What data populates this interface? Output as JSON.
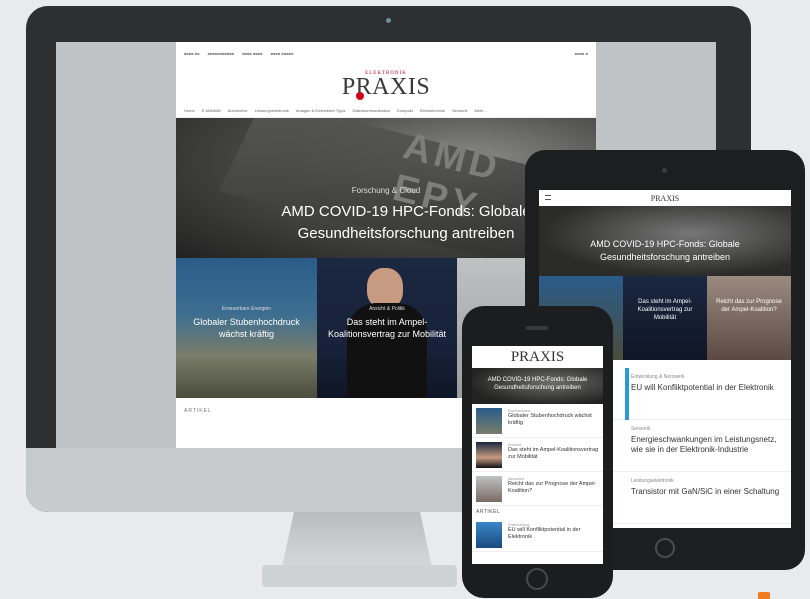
{
  "site": {
    "brand_kicker": "ELEKTRONIK",
    "brand_name": "PRAXIS",
    "topbar": [
      "■■■■ ■■",
      "■■■■■■■■■■■",
      "■■■■ ■■■■",
      "■■■■ ■■■■■"
    ],
    "topbar_right": "■■■■ ■",
    "nav": [
      "Home",
      "E-Mobilität",
      "Automotive",
      "Leistungselektronik",
      "Anlagen & Embedded Tipps",
      "Datenkommunikation",
      "Kompakt",
      "Elektrotechnik",
      "Sensorik",
      "Mehr..."
    ],
    "hero": {
      "kicker": "Forschung & Cloud",
      "title": "AMD COVID-19 HPC-Fonds: Globale Gesundheitsforschung antreiben",
      "chip_text": "AMD EPY"
    },
    "tiles": [
      {
        "kicker": "Erneuerbare Energien",
        "title": "Globaler Stubenhochdruck wächst kräftig"
      },
      {
        "kicker": "Ansicht & Politik",
        "title": "Das steht im Ampel-Koalitionsvertrag zur Mobilität"
      },
      {
        "kicker": "",
        "title": ""
      }
    ],
    "section_label": "ARTIKEL"
  },
  "tablet": {
    "logo": "PRAXIS",
    "hero_title": "AMD COVID-19 HPC-Fonds: Globale Gesundheitsforschung antreiben",
    "tiles": [
      {
        "title": ""
      },
      {
        "title": "Das steht im Ampel-Koalitionsvertrag zur Mobilität"
      },
      {
        "title": "Reicht das zur Prognose der Ampel-Koalition?"
      }
    ],
    "list": [
      {
        "kicker": "Entwicklung & Netzwerk",
        "title": "EU will Konfliktpotential in der Elektronik"
      },
      {
        "kicker": "Sensorik",
        "title": "Energieschwankungen im Leistungsnetz, wie sie in der Elektronik-Industrie"
      },
      {
        "kicker": "Leistungselektronik",
        "title": "Transistor mit GaN/SiC in einer Schaltung"
      }
    ]
  },
  "phone": {
    "logo": "PRAXIS",
    "hero_title": "AMD COVID-19 HPC-Fonds: Globale Gesundheitsforschung antreiben",
    "items": [
      {
        "kicker": "Erneuerbare",
        "title": "Globaler Stubenhochdruck wächst kräftig"
      },
      {
        "kicker": "Ansicht",
        "title": "Das steht im Ampel-Koalitionsvertrag zur Mobilität"
      },
      {
        "kicker": "Aktuelles",
        "title": "Reicht das zur Prognose der Ampel-Koalition?"
      }
    ],
    "section_label": "ARTIKEL",
    "extra": {
      "kicker": "Entwicklung",
      "title": "EU will Konfliktpotential in der Elektronik"
    }
  }
}
